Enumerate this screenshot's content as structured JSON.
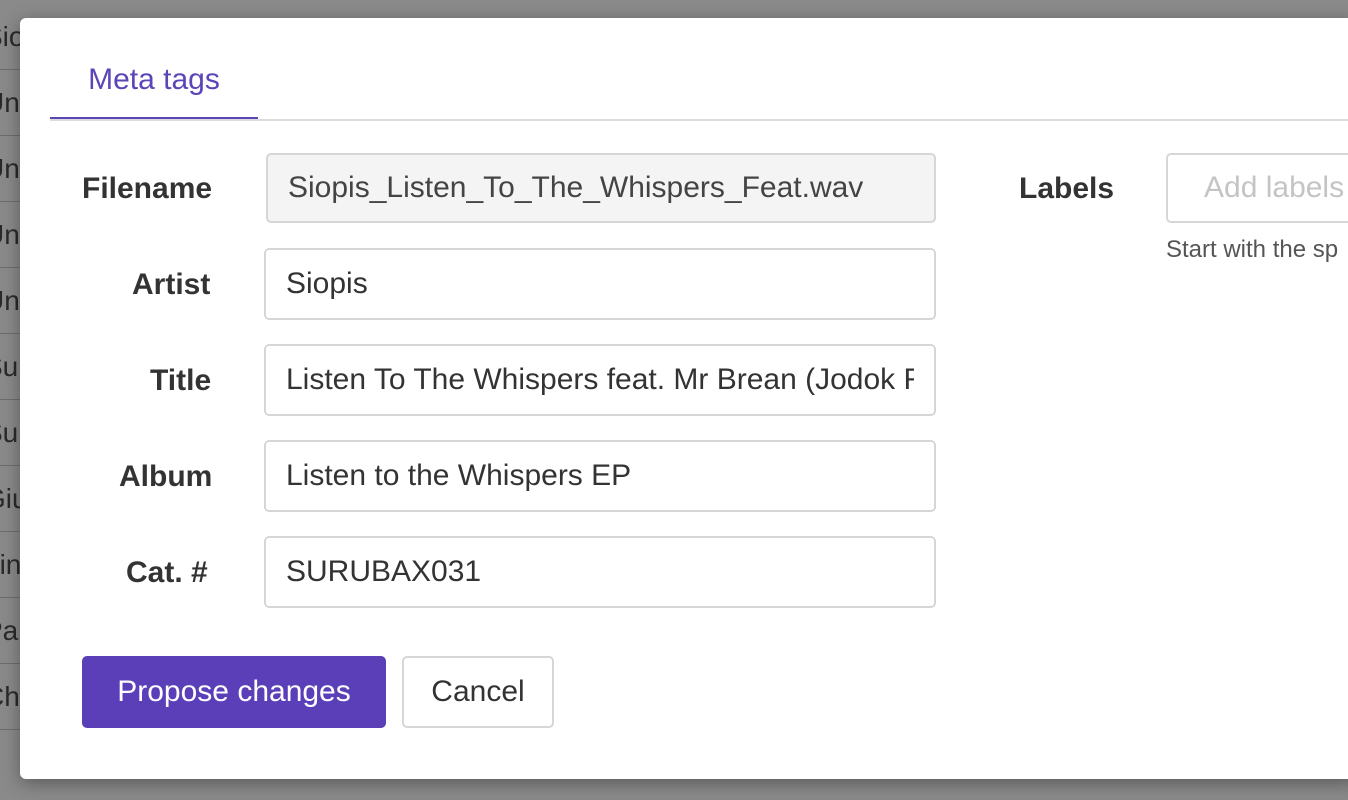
{
  "background": {
    "rows": [
      "Sio",
      "Un",
      "Un",
      "Un",
      "Un",
      "Su",
      "Su",
      "Giu",
      "Lin",
      "Pa",
      "Ch"
    ]
  },
  "tabs": {
    "meta_tags_label": "Meta tags"
  },
  "form": {
    "filename": {
      "label": "Filename",
      "value": "Siopis_Listen_To_The_Whispers_Feat.wav"
    },
    "artist": {
      "label": "Artist",
      "value": "Siopis"
    },
    "title": {
      "label": "Title",
      "value": "Listen To The Whispers feat. Mr Brean (Jodok Remix)"
    },
    "album": {
      "label": "Album",
      "value": "Listen to the Whispers EP"
    },
    "catalog": {
      "label": "Cat. #",
      "value": "SURUBAX031"
    },
    "labels": {
      "label": "Labels",
      "placeholder": "Add labels",
      "hint": "Start with the sp"
    }
  },
  "buttons": {
    "propose_label": "Propose changes",
    "cancel_label": "Cancel"
  },
  "colors": {
    "accent": "#5b3fb8",
    "tab_active": "#5b45b8"
  }
}
